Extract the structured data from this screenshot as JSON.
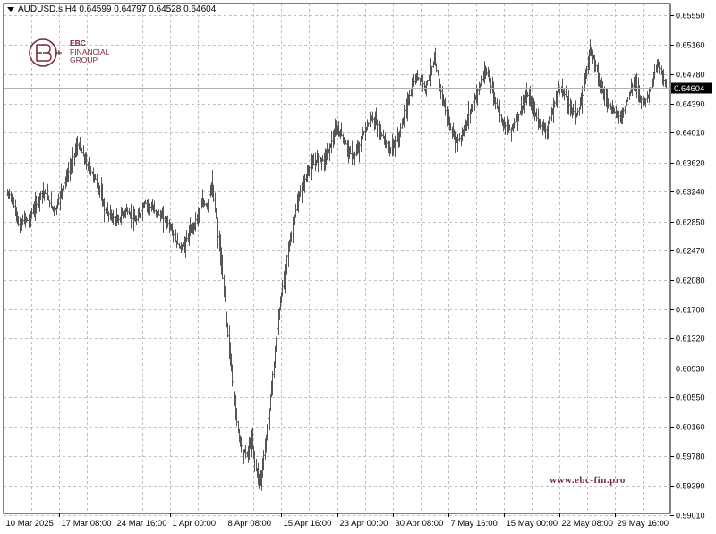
{
  "header": {
    "symbol_line": "AUDUSD.s,H4  0.64599 0.64797 0.64528 0.64604"
  },
  "logo": {
    "line1": "EBC",
    "line2": "FINANCIAL",
    "line3": "GROUP",
    "color": "#7a2a3a"
  },
  "watermark": "www.ebc-fin.pro",
  "colors": {
    "bars": "#555555",
    "grid": "#c0c0c0",
    "price_tag_bg": "#000000",
    "price_tag_fg": "#ffffff"
  },
  "chart_data": {
    "type": "line",
    "style": "ohlc-bars",
    "symbol": "AUDUSD.s",
    "timeframe": "H4",
    "last_price": 0.64604,
    "last_price_label": "0.64604",
    "ylim": [
      0.5903,
      0.657
    ],
    "y_ticks": [
      0.6555,
      0.6516,
      0.6478,
      0.6439,
      0.6401,
      0.6362,
      0.6324,
      0.6285,
      0.6247,
      0.6208,
      0.617,
      0.6132,
      0.6093,
      0.6055,
      0.6016,
      0.5978,
      0.5939,
      0.5901
    ],
    "y_tick_labels": [
      "0.65550",
      "0.65160",
      "0.64780",
      "0.64390",
      "0.64010",
      "0.63620",
      "0.63240",
      "0.62850",
      "0.62470",
      "0.62080",
      "0.61700",
      "0.61320",
      "0.60930",
      "0.60550",
      "0.60160",
      "0.59780",
      "0.59390",
      "0.59010"
    ],
    "x_tick_labels": [
      "10 Mar 2025",
      "17 Mar 08:00",
      "24 Mar 16:00",
      "1 Apr 00:00",
      "8 Apr 08:00",
      "15 Apr 16:00",
      "23 Apr 00:00",
      "30 Apr 08:00",
      "7 May 16:00",
      "15 May 00:00",
      "22 May 08:00",
      "29 May 16:00"
    ],
    "grid": true,
    "series": [
      {
        "closes": [
          0.632,
          0.63,
          0.6275,
          0.629,
          0.6285,
          0.63,
          0.631,
          0.6325,
          0.632,
          0.6305,
          0.63,
          0.632,
          0.6335,
          0.635,
          0.637,
          0.6385,
          0.6375,
          0.636,
          0.635,
          0.634,
          0.6325,
          0.63,
          0.6295,
          0.629,
          0.6285,
          0.6295,
          0.63,
          0.629,
          0.6285,
          0.6295,
          0.631,
          0.6305,
          0.63,
          0.6295,
          0.629,
          0.6285,
          0.6275,
          0.626,
          0.625,
          0.6255,
          0.627,
          0.628,
          0.6295,
          0.631,
          0.6305,
          0.6335,
          0.629,
          0.624,
          0.618,
          0.612,
          0.606,
          0.601,
          0.5985,
          0.598,
          0.6,
          0.596,
          0.5945,
          0.599,
          0.604,
          0.61,
          0.616,
          0.62,
          0.624,
          0.627,
          0.63,
          0.6325,
          0.634,
          0.6355,
          0.636,
          0.637,
          0.6365,
          0.6375,
          0.639,
          0.6405,
          0.64,
          0.639,
          0.6375,
          0.637,
          0.638,
          0.64,
          0.641,
          0.642,
          0.6415,
          0.64,
          0.639,
          0.638,
          0.6385,
          0.6395,
          0.642,
          0.644,
          0.646,
          0.6475,
          0.647,
          0.646,
          0.648,
          0.6495,
          0.647,
          0.644,
          0.642,
          0.64,
          0.639,
          0.6395,
          0.641,
          0.643,
          0.6445,
          0.646,
          0.6475,
          0.648,
          0.6455,
          0.6435,
          0.642,
          0.641,
          0.6405,
          0.6415,
          0.6425,
          0.644,
          0.645,
          0.6435,
          0.642,
          0.641,
          0.6405,
          0.642,
          0.644,
          0.646,
          0.6455,
          0.644,
          0.643,
          0.6425,
          0.644,
          0.648,
          0.651,
          0.6495,
          0.647,
          0.645,
          0.644,
          0.643,
          0.6425,
          0.642,
          0.644,
          0.6455,
          0.647,
          0.645,
          0.644,
          0.645,
          0.647,
          0.649,
          0.648,
          0.646
        ]
      }
    ]
  }
}
